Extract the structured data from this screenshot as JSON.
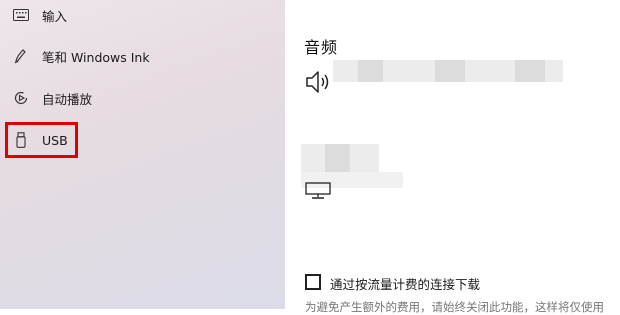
{
  "sidebar": {
    "items": [
      {
        "label": "输入",
        "icon": "keyboard-icon"
      },
      {
        "label": "笔和 Windows Ink",
        "icon": "pen-icon"
      },
      {
        "label": "自动播放",
        "icon": "autoplay-icon"
      },
      {
        "label": "USB",
        "icon": "usb-icon"
      }
    ],
    "highlight_color": "#e00000"
  },
  "main": {
    "section_title": "音频",
    "speaker_icon": "speaker-icon",
    "monitor_icon": "monitor-icon",
    "metered_checkbox_label": "通过按流量计费的连接下载",
    "metered_description": "为避免产生额外的费用，请始终关闭此功能，这样将仅使用"
  }
}
